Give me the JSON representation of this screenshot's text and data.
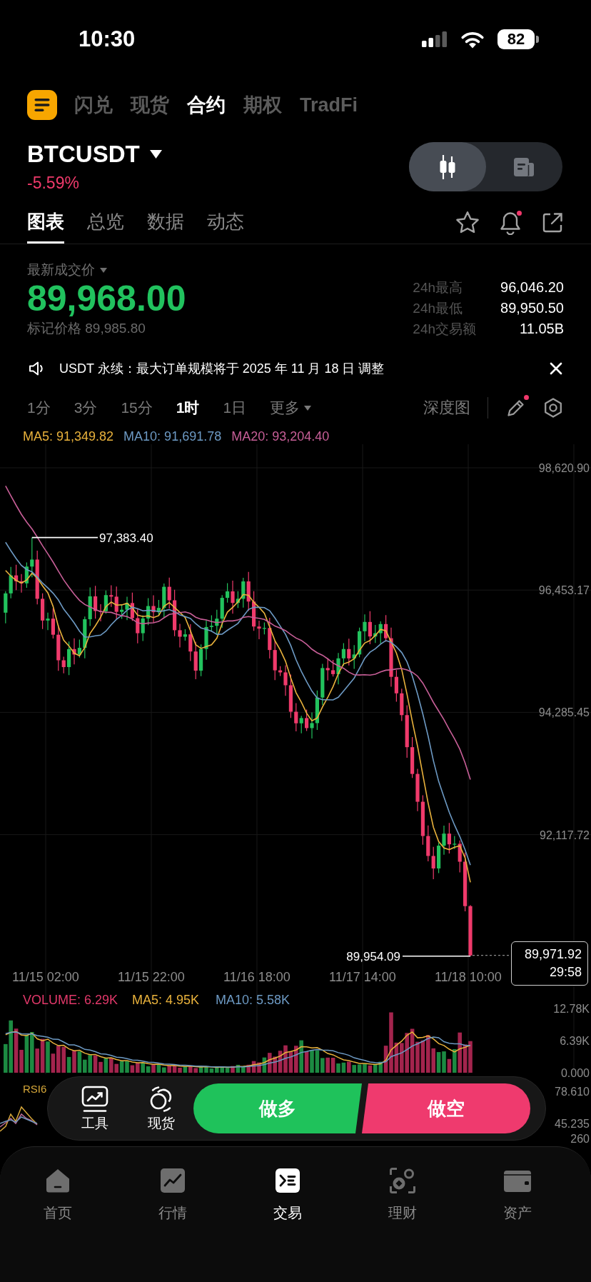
{
  "status_bar": {
    "time": "10:30",
    "battery": "82"
  },
  "product_tabs": [
    {
      "label": "闪兑",
      "selected": false
    },
    {
      "label": "现货",
      "selected": false
    },
    {
      "label": "合约",
      "selected": true
    },
    {
      "label": "期权",
      "selected": false
    },
    {
      "label": "TradFi",
      "selected": false
    }
  ],
  "instrument": {
    "symbol": "BTCUSDT",
    "change": "-5.59%",
    "view_toggle": [
      {
        "selected": true
      },
      {
        "selected": false
      }
    ]
  },
  "detail_tabs": {
    "items": [
      {
        "label": "图表",
        "selected": true
      },
      {
        "label": "总览",
        "selected": false
      },
      {
        "label": "数据",
        "selected": false
      },
      {
        "label": "动态",
        "selected": false
      }
    ],
    "alert_badge": true
  },
  "price": {
    "label": "最新成交价",
    "last": "89,968.00",
    "mark": "标记价格 89,985.80",
    "stats": [
      {
        "label": "24h最高",
        "value": "96,046.20"
      },
      {
        "label": "24h最低",
        "value": "89,950.50"
      },
      {
        "label": "24h交易额",
        "value": "11.05B"
      }
    ]
  },
  "notice": {
    "text": "USDT 永续：最大订单规模将于 2025 年 11 月 18 日 调整"
  },
  "intervals": {
    "items": [
      {
        "label": "1分",
        "kind": "interval",
        "selected": false
      },
      {
        "label": "3分",
        "kind": "interval",
        "selected": false
      },
      {
        "label": "15分",
        "kind": "interval",
        "selected": false
      },
      {
        "label": "1时",
        "kind": "interval",
        "selected": true
      },
      {
        "label": "1日",
        "kind": "interval",
        "selected": false
      },
      {
        "label": "更多",
        "kind": "menu",
        "selected": false
      }
    ],
    "depth": "深度图",
    "drawing_badge": true
  },
  "chart": {
    "ma": [
      {
        "label": "MA5: 91,349.82",
        "color": "#e9b23c"
      },
      {
        "label": "MA10: 91,691.78",
        "color": "#6d9ac4"
      },
      {
        "label": "MA20: 93,204.40",
        "color": "#c85f98"
      }
    ],
    "y_labels": [
      "98,620.90",
      "96,453.17",
      "94,285.45",
      "92,117.72"
    ],
    "x_labels": [
      "11/15 02:00",
      "11/15 22:00",
      "11/16 18:00",
      "11/17 14:00",
      "11/18 10:00"
    ],
    "high": "97,383.40",
    "low": "89,954.09",
    "last_price": "89,971.92",
    "countdown": "29:58"
  },
  "volume": {
    "legend": [
      {
        "label": "VOLUME: 6.29K",
        "color": "#e2386a"
      },
      {
        "label": "MA5: 4.95K",
        "color": "#e9b23c"
      },
      {
        "label": "MA10: 5.58K",
        "color": "#6d9ac4"
      }
    ],
    "y_labels": [
      "12.78K",
      "6.39K",
      "0.000"
    ]
  },
  "rsi": {
    "label": "RSI6",
    "y_labels": [
      "78.610",
      "45.235",
      "260"
    ]
  },
  "trade_bar": {
    "tools": [
      {
        "label": "工具"
      },
      {
        "label": "现货"
      }
    ],
    "long": "做多",
    "short": "做空"
  },
  "bottom_nav": [
    {
      "label": "首页",
      "selected": false
    },
    {
      "label": "行情",
      "selected": false
    },
    {
      "label": "交易",
      "selected": true
    },
    {
      "label": "理财",
      "selected": false
    },
    {
      "label": "资产",
      "selected": false
    }
  ]
}
